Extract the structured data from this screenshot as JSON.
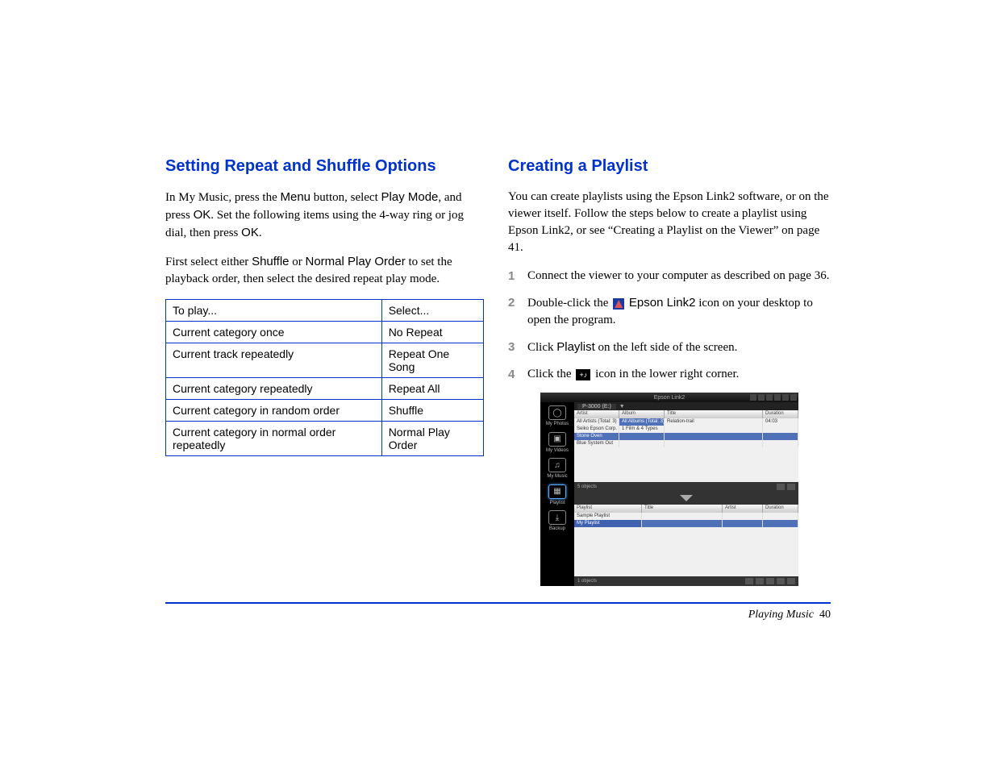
{
  "left": {
    "heading": "Setting Repeat and Shuffle Options",
    "para1": {
      "t1": "In My Music, press the ",
      "menu": "Menu",
      "t2": " button, select ",
      "playmode": "Play Mode",
      "t3": ", and press ",
      "ok1": "OK",
      "t4": ". Set the following items using the 4-way ring or jog dial, then press ",
      "ok2": "OK",
      "t5": "."
    },
    "para2": {
      "t1": "First select either ",
      "shuffle": "Shuffle",
      "t2": " or ",
      "normal": "Normal Play Order",
      "t3": " to set the playback order, then select the desired repeat play mode."
    },
    "table": {
      "head": {
        "c1": "To play...",
        "c2": "Select..."
      },
      "rows": [
        {
          "c1": "Current category once",
          "c2": "No Repeat"
        },
        {
          "c1": "Current track repeatedly",
          "c2": "Repeat One Song"
        },
        {
          "c1": "Current category repeatedly",
          "c2": "Repeat All"
        },
        {
          "c1": "Current category in random order",
          "c2": "Shuffle"
        },
        {
          "c1": "Current category in normal order repeatedly",
          "c2": "Normal Play Order"
        }
      ]
    }
  },
  "right": {
    "heading": "Creating a Playlist",
    "intro": "You can create playlists using the Epson Link2 software, or on the viewer itself. Follow the steps below to create a playlist using Epson Link2, or see “Creating a Playlist on the Viewer” on page 41.",
    "steps": {
      "s1": "Connect the viewer to your computer as described on page 36.",
      "s2": {
        "t1": "Double-click the ",
        "link2": "Epson Link2",
        "t2": " icon on your desktop to open the program."
      },
      "s3": {
        "t1": "Click ",
        "playlist": "Playlist",
        "t2": " on the left side of the screen."
      },
      "s4": {
        "t1": "Click the ",
        "t2": " icon in the lower right corner."
      }
    }
  },
  "screenshot": {
    "title": "Epson Link2",
    "drive": "P-3000 (E:)",
    "sidebar": [
      {
        "icon": "◯",
        "label": "My Photos"
      },
      {
        "icon": "▣",
        "label": "My Videos"
      },
      {
        "icon": "♫",
        "label": "My Music"
      },
      {
        "icon": "▦",
        "label": "Playlist"
      },
      {
        "icon": "⤓",
        "label": "Backup"
      }
    ],
    "upper": {
      "headers": {
        "artist": "Artist",
        "album": "Album",
        "title": "Title",
        "duration": "Duration"
      },
      "rows": [
        {
          "artist": "All Artists (Total: 3)",
          "album": "All Albums (Total: 3)",
          "title": "Relation-trail",
          "duration": "04:03"
        },
        {
          "artist": "Seiko Epson Corp.",
          "album": "1 Film & 4 Types",
          "title": "",
          "duration": ""
        },
        {
          "artist": "Stone Oven",
          "album": "",
          "title": "",
          "duration": ""
        },
        {
          "artist": "Blue System Out",
          "album": "",
          "title": "",
          "duration": ""
        }
      ],
      "status": "5 objects"
    },
    "lower": {
      "headers": {
        "playlist": "Playlist",
        "title": "Title",
        "artist": "Artist",
        "duration": "Duration"
      },
      "rows": [
        {
          "playlist": "Sample Playlist"
        },
        {
          "playlist": "My Playlist"
        }
      ],
      "status": "1 objects"
    }
  },
  "footer": {
    "section": "Playing Music",
    "page": "40"
  }
}
